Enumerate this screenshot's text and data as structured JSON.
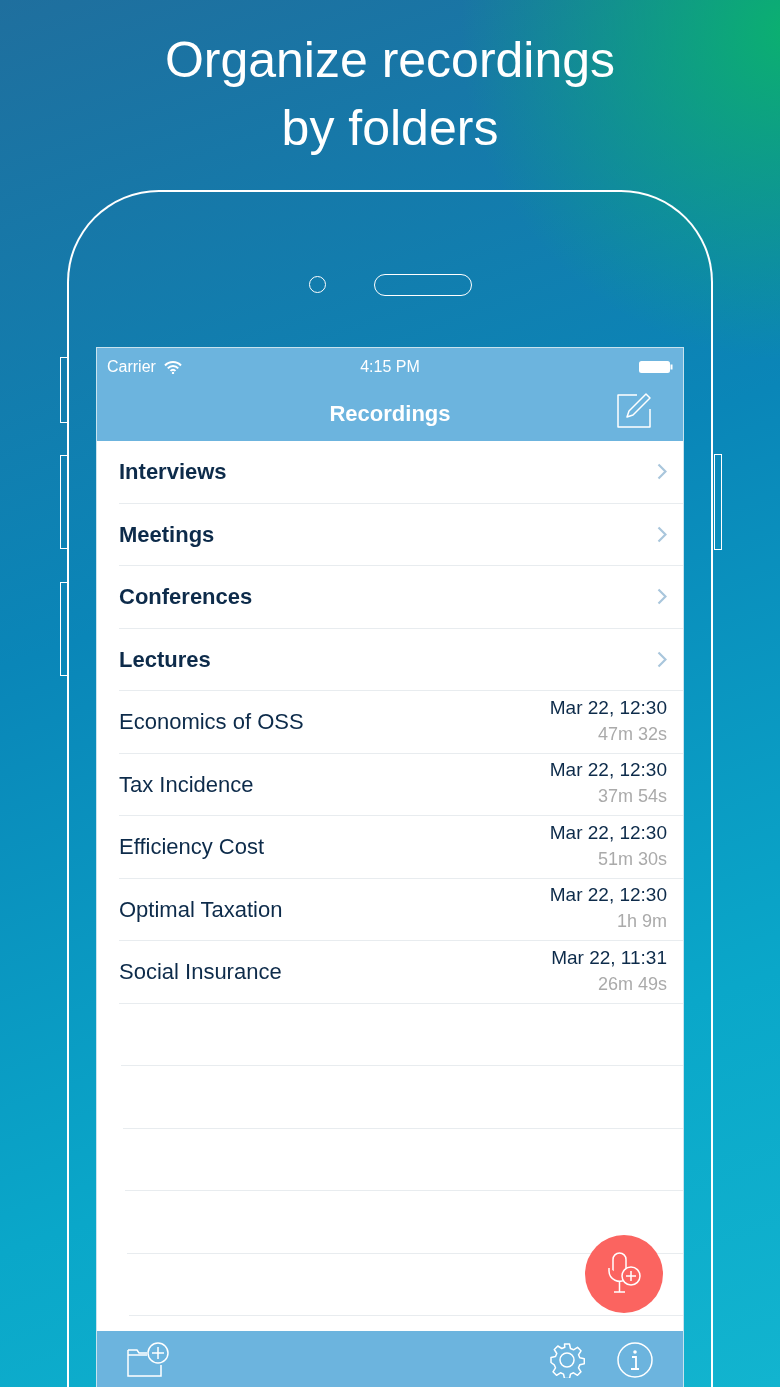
{
  "headline": [
    "Organize recordings",
    "by folders"
  ],
  "status_bar": {
    "carrier": "Carrier",
    "time": "4:15 PM"
  },
  "nav": {
    "title": "Recordings"
  },
  "items": [
    {
      "kind": "folder",
      "title": "Interviews"
    },
    {
      "kind": "folder",
      "title": "Meetings"
    },
    {
      "kind": "folder",
      "title": "Conferences"
    },
    {
      "kind": "folder",
      "title": "Lectures"
    },
    {
      "kind": "recording",
      "title": "Economics of OSS",
      "date": "Mar 22, 12:30",
      "duration": "47m 32s"
    },
    {
      "kind": "recording",
      "title": "Tax Incidence",
      "date": "Mar 22, 12:30",
      "duration": "37m 54s"
    },
    {
      "kind": "recording",
      "title": "Efficiency Cost",
      "date": "Mar 22, 12:30",
      "duration": "51m 30s"
    },
    {
      "kind": "recording",
      "title": "Optimal Taxation",
      "date": "Mar 22, 12:30",
      "duration": "1h 9m"
    },
    {
      "kind": "recording",
      "title": "Social Insurance",
      "date": "Mar 22, 11:31",
      "duration": "26m 49s"
    }
  ]
}
